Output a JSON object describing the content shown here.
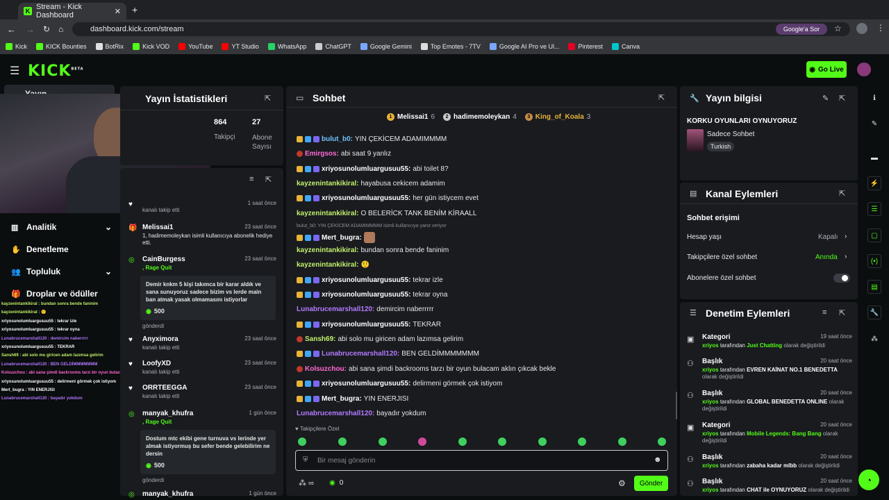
{
  "browser": {
    "tab_title": "Stream - Kick Dashboard",
    "url": "dashboard.kick.com/stream",
    "google_ask": "Google'a Sor",
    "bookmarks": [
      "Kick",
      "KICK Bounties",
      "BotRix",
      "Kick VOD",
      "YouTube",
      "YT Studio",
      "WhatsApp",
      "ChatGPT",
      "Google Gemini",
      "Top Emotes - 7TV",
      "Google AI Pro ve Ul...",
      "Pinterest",
      "Canva"
    ]
  },
  "header": {
    "logo": "KICK",
    "beta": "BETA",
    "go_live": "Go Live"
  },
  "nav": {
    "stream_label": "Yayın",
    "items": [
      "Analitik",
      "Denetleme",
      "Topluluk",
      "Droplar ve ödüller"
    ]
  },
  "stats": {
    "title": "Yayın İstatistikleri",
    "followers_value": "864",
    "followers_label": "Takipçi",
    "subs_value": "27",
    "subs_label": "Abone Sayısı"
  },
  "overlay_chat": [
    "kayzenintankikiral : bundan sonra bende faninim",
    "kayzenintankikiral : 🤨",
    "xriyosunolumluargusuu55 : tekrar izle",
    "xriyosunolumluargusuu55 : tekrar oyna",
    "Lunabrucemarshall120 : demircim naberrrrr",
    "xriyosunolumluargusuu55 : TEKRAR",
    "Sansh69 : abi solo mu giricen adam lazımsa gelirim",
    "Lunabrucemarshall120 : BEN GELDİMMMMMMM",
    "Kolsuzchou : abi sana şimdi backrooms tarzı bir oyun bulacam aklın çıkcak bekle",
    "xriyosunolumluargusuu55 : delirmeni görmek çok istiyom",
    "Mert_bugra : YIN ENERJISI",
    "Lunabrucemarshall120 : bayadır yokdum"
  ],
  "feed": {
    "items": [
      {
        "name": "",
        "time": "1 saat önce",
        "desc": "kanalı takip etti"
      },
      {
        "name": "Melissai1",
        "time": "23 saat önce",
        "desc": "1, hadimemoleykan isimli kullanıcıya abonelik hediye etti."
      },
      {
        "name": "CainBurgess",
        "time": "23 saat önce",
        "desc": ", Rage Quit",
        "msg": "Demir knkm 5 kişi takımca bir karar aldık ve sana sunuyoruz sadece bizim vs lerde main ban atmak yasak olmamasını istiyorlar",
        "amount": "500",
        "sent": "gönderdi"
      },
      {
        "name": "Anyximora",
        "time": "23 saat önce",
        "desc": "kanalı takip etti"
      },
      {
        "name": "LoofyXD",
        "time": "23 saat önce",
        "desc": "kanalı takip etti"
      },
      {
        "name": "ORRTEEGGA",
        "time": "23 saat önce",
        "desc": "kanalı takip etti"
      },
      {
        "name": "manyak_khufra",
        "time": "1 gün önce",
        "desc": ", Rage Quit",
        "msg": "Dostum mtc ekibi gene turnuva vs lerinde yer almak istiyormuş bu sefer bende gelebilirim ne dersin",
        "amount": "500",
        "sent": "gönderdi"
      },
      {
        "name": "manyak_khufra",
        "time": "1 gün önce",
        "desc": ""
      }
    ]
  },
  "chat": {
    "title": "Sohbet",
    "leaders": [
      {
        "rank": "1",
        "name": "Melissai1",
        "count": "6"
      },
      {
        "rank": "2",
        "name": "hadimemoleykan",
        "count": "4"
      },
      {
        "rank": "3",
        "name": "King_of_Koala",
        "count": "3"
      }
    ],
    "messages": [
      {
        "user": "bulut_b0:",
        "text": "YIN ÇEKİCEM ADAMIMMMM",
        "color": "#6ec4ff"
      },
      {
        "user": "Emirgsos:",
        "text": "abi saat 9 yanlız",
        "color": "#ff6bd5"
      },
      {
        "user": "xriyosunolumluargusuu55:",
        "text": "abi toilet 8?",
        "color": "#ffffff"
      },
      {
        "user": "kayzenintankikiral:",
        "text": "hayabusa cekicem adamim",
        "color": "#c1f06d"
      },
      {
        "user": "xriyosunolumluargusuu55:",
        "text": "her gün istiycem evet",
        "color": "#ffffff"
      },
      {
        "user": "kayzenintankikiral:",
        "text": "O BELERİCK TANK BENİM KİRAALL",
        "color": "#c1f06d"
      },
      {
        "user": "Mert_bugra:",
        "text": "",
        "color": "#ffffff",
        "reply": "bulut_b0: YIN ÇEKİCEM ADAMIMMMM isimli kullanıcıya yanıt veriyor"
      },
      {
        "user": "kayzenintankikiral:",
        "text": "bundan sonra bende faninim",
        "color": "#c1f06d"
      },
      {
        "user": "kayzenintankikiral:",
        "text": "🤨",
        "color": "#c1f06d"
      },
      {
        "user": "xriyosunolumluargusuu55:",
        "text": "tekrar izle",
        "color": "#ffffff"
      },
      {
        "user": "xriyosunolumluargusuu55:",
        "text": "tekrar oyna",
        "color": "#ffffff"
      },
      {
        "user": "Lunabrucemarshall120:",
        "text": "demircim naberrrrr",
        "color": "#b37bff"
      },
      {
        "user": "xriyosunolumluargusuu55:",
        "text": "TEKRAR",
        "color": "#ffffff"
      },
      {
        "user": "Sansh69:",
        "text": "abi solo mu giricen adam lazımsa gelirim",
        "color": "#c1f06d"
      },
      {
        "user": "Lunabrucemarshall120:",
        "text": "BEN GELDİMMMMMMM",
        "color": "#b37bff"
      },
      {
        "user": "Kolsuzchou:",
        "text": "abi sana şimdi backrooms tarzı bir oyun bulacam aklın çıkcak bekle",
        "color": "#ff6bd5"
      },
      {
        "user": "xriyosunolumluargusuu55:",
        "text": "delirmeni görmek çok istiyom",
        "color": "#ffffff"
      },
      {
        "user": "Mert_bugra:",
        "text": "YIN ENERJISI",
        "color": "#ffffff"
      },
      {
        "user": "Lunabrucemarshall120:",
        "text": "bayadır yokdum",
        "color": "#b37bff"
      }
    ],
    "emote_label": "Takipçilere Özel",
    "placeholder": "Bir mesaj gönderin",
    "points": "0",
    "send": "Gönder"
  },
  "info": {
    "title": "Yayın bilgisi",
    "stream_title": "KORKU OYUNLARI OYNUYORUZ",
    "category": "Sadece Sohbet",
    "language": "Turkish"
  },
  "channel_actions": {
    "title": "Kanal Eylemleri",
    "section": "Sohbet erişimi",
    "rows": [
      {
        "label": "Hesap yaşı",
        "value": "Kapalı"
      },
      {
        "label": "Takipçilere özel sohbet",
        "value": "Anında"
      },
      {
        "label": "Abonelere özel sohbet",
        "value": ""
      }
    ]
  },
  "mod_actions": {
    "title": "Denetim Eylemleri",
    "items": [
      {
        "type": "Kategori",
        "time": "19 saat önce",
        "user": "xriyos",
        "mid": "tarafından",
        "val": "Just Chatting",
        "end": "olarak değiştirildi"
      },
      {
        "type": "Başlık",
        "time": "20 saat önce",
        "user": "xriyos",
        "mid": "tarafından",
        "val": "EVREN KAİNAT NO.1 BENEDETTA",
        "end": "olarak değiştirildi"
      },
      {
        "type": "Başlık",
        "time": "20 saat önce",
        "user": "xriyos",
        "mid": "tarafından",
        "val": "GLOBAL BENEDETTA ONLINE",
        "end": "olarak değiştirildi"
      },
      {
        "type": "Kategori",
        "time": "20 saat önce",
        "user": "xriyos",
        "mid": "tarafından",
        "val": "Mobile Legends: Bang Bang",
        "end": "olarak değiştirildi"
      },
      {
        "type": "Başlık",
        "time": "20 saat önce",
        "user": "xriyos",
        "mid": "tarafından",
        "val": "zabaha kadar mlbb",
        "end": "olarak değiştirildi"
      },
      {
        "type": "Başlık",
        "time": "20 saat önce",
        "user": "xriyos",
        "mid": "tarafından",
        "val": "CHAT ile OYNUYORUZ",
        "end": "olarak değiştirildi"
      }
    ]
  },
  "colors": {
    "accent": "#53fc18",
    "panel": "#191b1f",
    "bg": "#0b0e0f"
  }
}
